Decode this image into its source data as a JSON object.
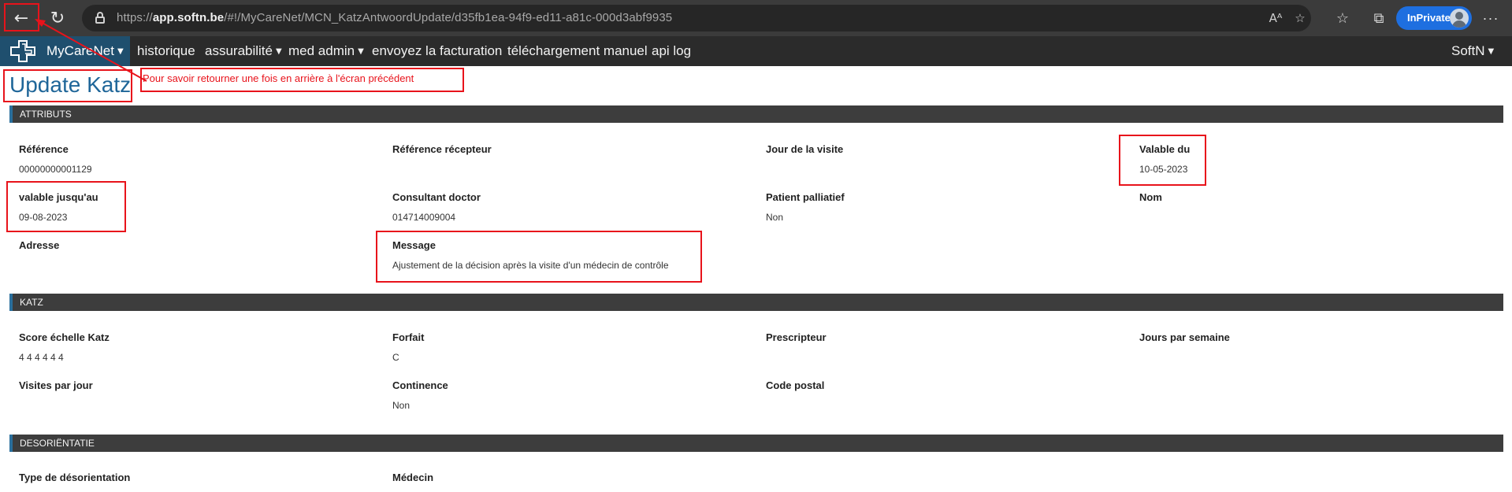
{
  "browser": {
    "url_scheme": "https://",
    "url_host": "app.softn.be",
    "url_path": "/#!/MyCareNet/MCN_KatzAntwoordUpdate/d35fb1ea-94f9-ed11-a81c-000d3abf9935",
    "inprivate_label": "InPrivate",
    "read_aloud_icon": "Aᴬ",
    "more_label": "···"
  },
  "nav": {
    "brand": "MyCareNet",
    "items": [
      "historique",
      "assurabilité",
      "med admin",
      "envoyez la facturation",
      "téléchargement manuel",
      "api log"
    ],
    "user": "SoftN"
  },
  "page": {
    "title": "Update Katz",
    "annotation": "Pour savoir retourner une fois en arrière à l'écran précédent"
  },
  "sections": {
    "attributs": {
      "title": "ATTRIBUTS",
      "fields": [
        {
          "label": "Référence",
          "value": "00000000001129"
        },
        {
          "label": "Référence récepteur",
          "value": ""
        },
        {
          "label": "Jour de la visite",
          "value": ""
        },
        {
          "label": "Valable du",
          "value": "10-05-2023"
        },
        {
          "label": "valable jusqu'au",
          "value": "09-08-2023"
        },
        {
          "label": "Consultant doctor",
          "value": "014714009004"
        },
        {
          "label": "Patient palliatief",
          "value": "Non"
        },
        {
          "label": "Nom",
          "value": ""
        },
        {
          "label": "Adresse",
          "value": ""
        },
        {
          "label": "Message",
          "value": "Ajustement de la décision après la visite d'un médecin de contrôle"
        }
      ]
    },
    "katz": {
      "title": "KATZ",
      "fields": [
        {
          "label": "Score échelle Katz",
          "value": "4 4 4 4 4 4"
        },
        {
          "label": "Forfait",
          "value": "C"
        },
        {
          "label": "Prescripteur",
          "value": ""
        },
        {
          "label": "Jours par semaine",
          "value": ""
        },
        {
          "label": "Visites par jour",
          "value": ""
        },
        {
          "label": "Continence",
          "value": "Non"
        },
        {
          "label": "Code postal",
          "value": ""
        }
      ]
    },
    "desorientatie": {
      "title": "DESORIËNTATIE",
      "fields": [
        {
          "label": "Type de désorientation",
          "value": ""
        },
        {
          "label": "Médecin",
          "value": ""
        }
      ]
    }
  }
}
